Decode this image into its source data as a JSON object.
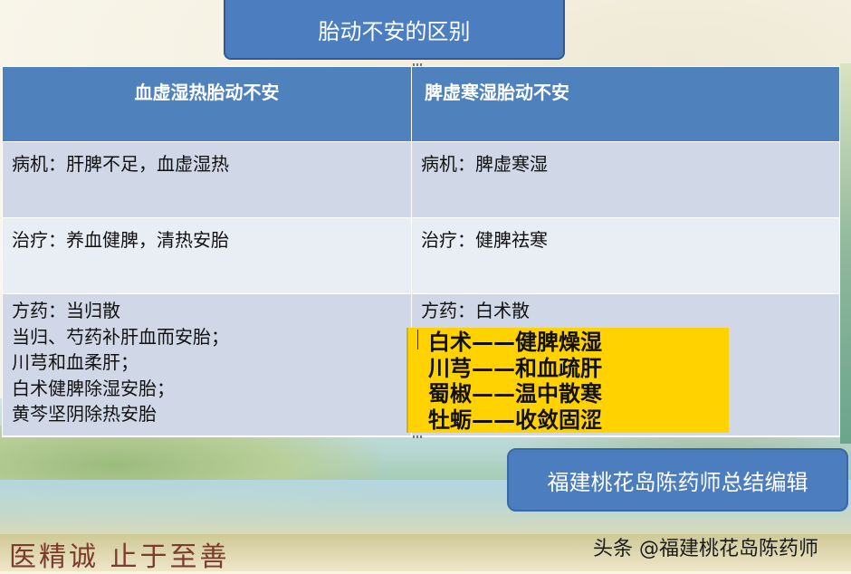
{
  "slide": {
    "title": "胎动不安的区别",
    "table": {
      "headers": [
        "血虚湿热胎动不安",
        "脾虚寒湿胎动不安"
      ],
      "rows": [
        [
          "病机：肝脾不足，血虚湿热",
          "病机：脾虚寒湿"
        ],
        [
          "治疗：养血健脾，清热安胎",
          "治疗：健脾祛寒"
        ],
        [
          [
            "方药：当归散",
            "当归、芍药补肝血而安胎；",
            "川芎和血柔肝；",
            "白术健脾除湿安胎；",
            "黄芩坚阴除热安胎"
          ],
          [
            "方药：白术散"
          ]
        ]
      ]
    },
    "herbs": [
      "白术——健脾燥湿",
      "川芎——和血疏肝",
      "蜀椒——温中散寒",
      "牡蛎——收敛固涩"
    ],
    "credit": "福建桃花岛陈药师总结编辑",
    "logo_text": "医精诚 止于至善",
    "watermark": "头条 @福建桃花岛陈药师"
  },
  "colors": {
    "header_blue": "#4f81bd",
    "row_dark": "#d0d8e8",
    "row_light": "#e9edf4",
    "highlight_yellow": "#ffd200"
  }
}
